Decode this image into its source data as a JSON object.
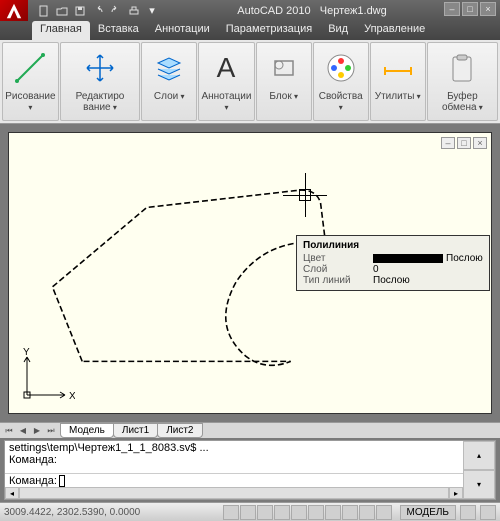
{
  "title": {
    "app": "AutoCAD 2010",
    "doc": "Чертеж1.dwg"
  },
  "ribbon": {
    "tabs": [
      "Главная",
      "Вставка",
      "Аннотации",
      "Параметризация",
      "Вид",
      "Управление"
    ],
    "active": 0,
    "groups": [
      {
        "label": "Рисование"
      },
      {
        "label": "Редактиро\nвание"
      },
      {
        "label": "Слои"
      },
      {
        "label": "Аннотации"
      },
      {
        "label": "Блок"
      },
      {
        "label": "Свойства"
      },
      {
        "label": "Утилиты"
      },
      {
        "label": "Буфер\nобмена"
      }
    ]
  },
  "tooltip": {
    "title": "Полилиния",
    "rows": [
      {
        "k": "Цвет",
        "v": "Послою",
        "swatch": true
      },
      {
        "k": "Слой",
        "v": "0"
      },
      {
        "k": "Тип линий",
        "v": "Послою"
      }
    ]
  },
  "axes": {
    "x": "X",
    "y": "Y"
  },
  "sheets": {
    "tabs": [
      "Модель",
      "Лист1",
      "Лист2"
    ],
    "active": 0
  },
  "command": {
    "history": "settings\\temp\\Чертеж1_1_1_8083.sv$ ...\nКоманда:",
    "prompt": "Команда:"
  },
  "status": {
    "coords": "3009.4422, 2302.5390, 0.0000",
    "space": "МОДЕЛЬ"
  }
}
